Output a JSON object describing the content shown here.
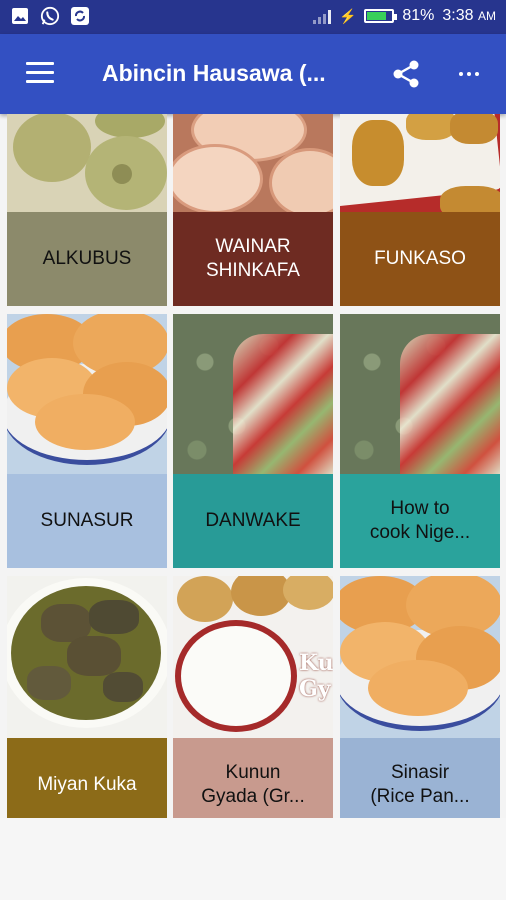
{
  "status_bar": {
    "battery_percent": "81%",
    "time": "3:38",
    "ampm": "AM",
    "icons": [
      "gallery-icon",
      "whatsapp-icon",
      "sync-icon",
      "signal-icon",
      "charging-icon",
      "battery-icon"
    ],
    "battery_level": 0.81
  },
  "app_bar": {
    "title": "Abincin Hausawa (...",
    "icons": [
      "menu-icon",
      "share-icon",
      "more-vert-icon"
    ]
  },
  "items": [
    {
      "label": "ALKUBUS",
      "label_bg": "#8c8a6b",
      "label_color": "#111111",
      "image": "steamed-bread-photo"
    },
    {
      "label": "WAINAR\nSHINKAFA",
      "label_bg": "#6e2b22",
      "label_color": "#ffffff",
      "image": "rice-cakes-photo"
    },
    {
      "label": "FUNKASO",
      "label_bg": "#8e5216",
      "label_color": "#ffffff",
      "image": "fried-dough-photo"
    },
    {
      "label": "SUNASUR",
      "label_bg": "#a8c0df",
      "label_color": "#111111",
      "image": "pancakes-photo"
    },
    {
      "label": "DANWAKE",
      "label_bg": "#289b97",
      "label_color": "#111111",
      "image": "dumplings-salad-photo"
    },
    {
      "label": "How to\ncook Nige...",
      "label_bg": "#2aa39c",
      "label_color": "#111111",
      "image": "dumplings-salad-photo"
    },
    {
      "label": "Miyan Kuka",
      "label_bg": "#8c6b18",
      "label_color": "#ffffff",
      "image": "soup-photo"
    },
    {
      "label": "Kunun\nGyada (Gr...",
      "label_bg": "#c89a8e",
      "label_color": "#111111",
      "image": "groundnut-porridge-photo",
      "image_text": "Ku\nGy"
    },
    {
      "label": "Sinasir\n(Rice Pan...",
      "label_bg": "#9ab3d4",
      "label_color": "#111111",
      "image": "pancakes-photo"
    }
  ]
}
